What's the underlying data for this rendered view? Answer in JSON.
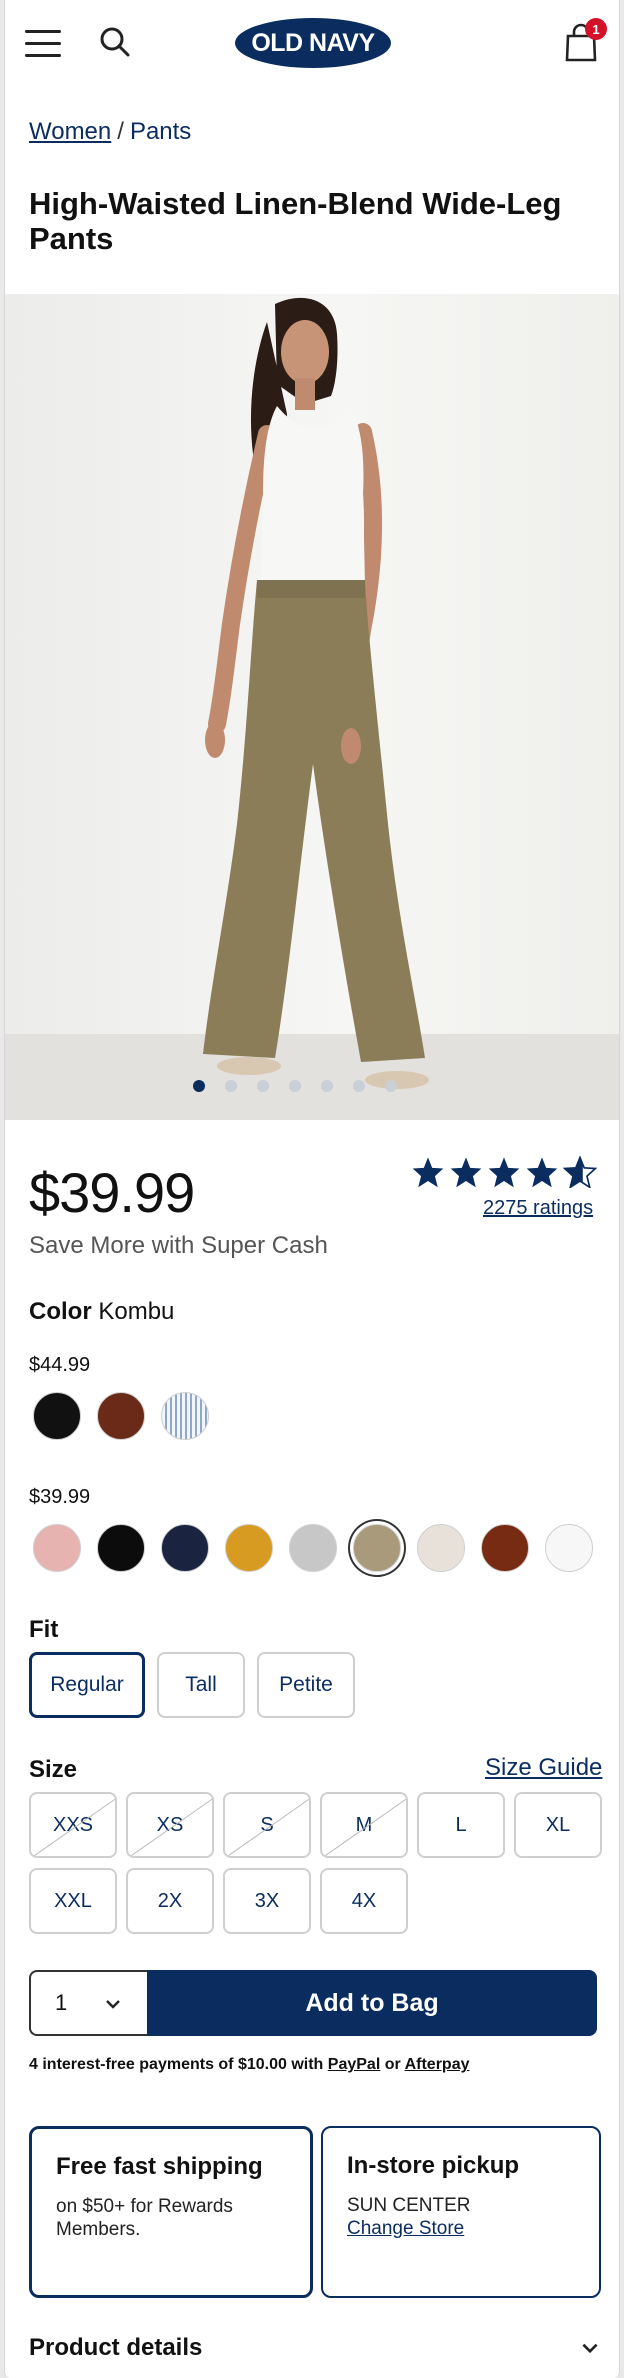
{
  "header": {
    "logo_text": "OLD NAVY",
    "bag_count": "1"
  },
  "breadcrumb": {
    "parent": "Women",
    "separator": "/",
    "current": "Pants"
  },
  "product": {
    "title": "High-Waisted Linen-Blend Wide-Leg Pants",
    "price": "$39.99",
    "supercash": "Save More with Super Cash",
    "rating_value": 4.5,
    "rating_max": 5,
    "ratings_count": "2275 ratings"
  },
  "gallery": {
    "image_count": 7,
    "active_index": 0
  },
  "color": {
    "label": "Color",
    "selected_name": "Kombu",
    "tiers": [
      {
        "price": "$44.99",
        "swatches": [
          {
            "name": "black",
            "hex": "#111111"
          },
          {
            "name": "rust-brown",
            "hex": "#6b2a18"
          },
          {
            "name": "blue-stripe",
            "hex": "#b9cbe0"
          }
        ]
      },
      {
        "price": "$39.99",
        "swatches": [
          {
            "name": "pink",
            "hex": "#e6b3b1"
          },
          {
            "name": "black",
            "hex": "#0c0c0c"
          },
          {
            "name": "navy",
            "hex": "#1a2440"
          },
          {
            "name": "mustard",
            "hex": "#d89b21"
          },
          {
            "name": "heather-gray",
            "hex": "#c7c7c7"
          },
          {
            "name": "kombu",
            "hex": "#a89a7a",
            "selected": true
          },
          {
            "name": "oatmeal",
            "hex": "#e8e1d9"
          },
          {
            "name": "brown",
            "hex": "#762b12"
          },
          {
            "name": "white",
            "hex": "#f7f7f7"
          }
        ]
      }
    ]
  },
  "fit": {
    "label": "Fit",
    "options": [
      "Regular",
      "Tall",
      "Petite"
    ],
    "selected": "Regular"
  },
  "size": {
    "label": "Size",
    "guide_link": "Size Guide",
    "options": [
      {
        "label": "XXS",
        "available": false
      },
      {
        "label": "XS",
        "available": false
      },
      {
        "label": "S",
        "available": false
      },
      {
        "label": "M",
        "available": false
      },
      {
        "label": "L",
        "available": true
      },
      {
        "label": "XL",
        "available": true
      },
      {
        "label": "XXL",
        "available": true
      },
      {
        "label": "2X",
        "available": true
      },
      {
        "label": "3X",
        "available": true
      },
      {
        "label": "4X",
        "available": true
      }
    ]
  },
  "purchase": {
    "quantity": "1",
    "add_to_bag": "Add to Bag",
    "installments_text": "4 interest-free payments of $10.00 with",
    "paypal": "PayPal",
    "or": "or",
    "afterpay": "Afterpay"
  },
  "fulfillment": {
    "shipping_title": "Free fast shipping",
    "shipping_desc": "on $50+ for Rewards Members.",
    "pickup_title": "In-store pickup",
    "pickup_store": "SUN CENTER",
    "pickup_change": "Change Store"
  },
  "details": {
    "label": "Product details"
  },
  "colors": {
    "brand_navy": "#0a2c5f",
    "badge_red": "#d3122a"
  }
}
